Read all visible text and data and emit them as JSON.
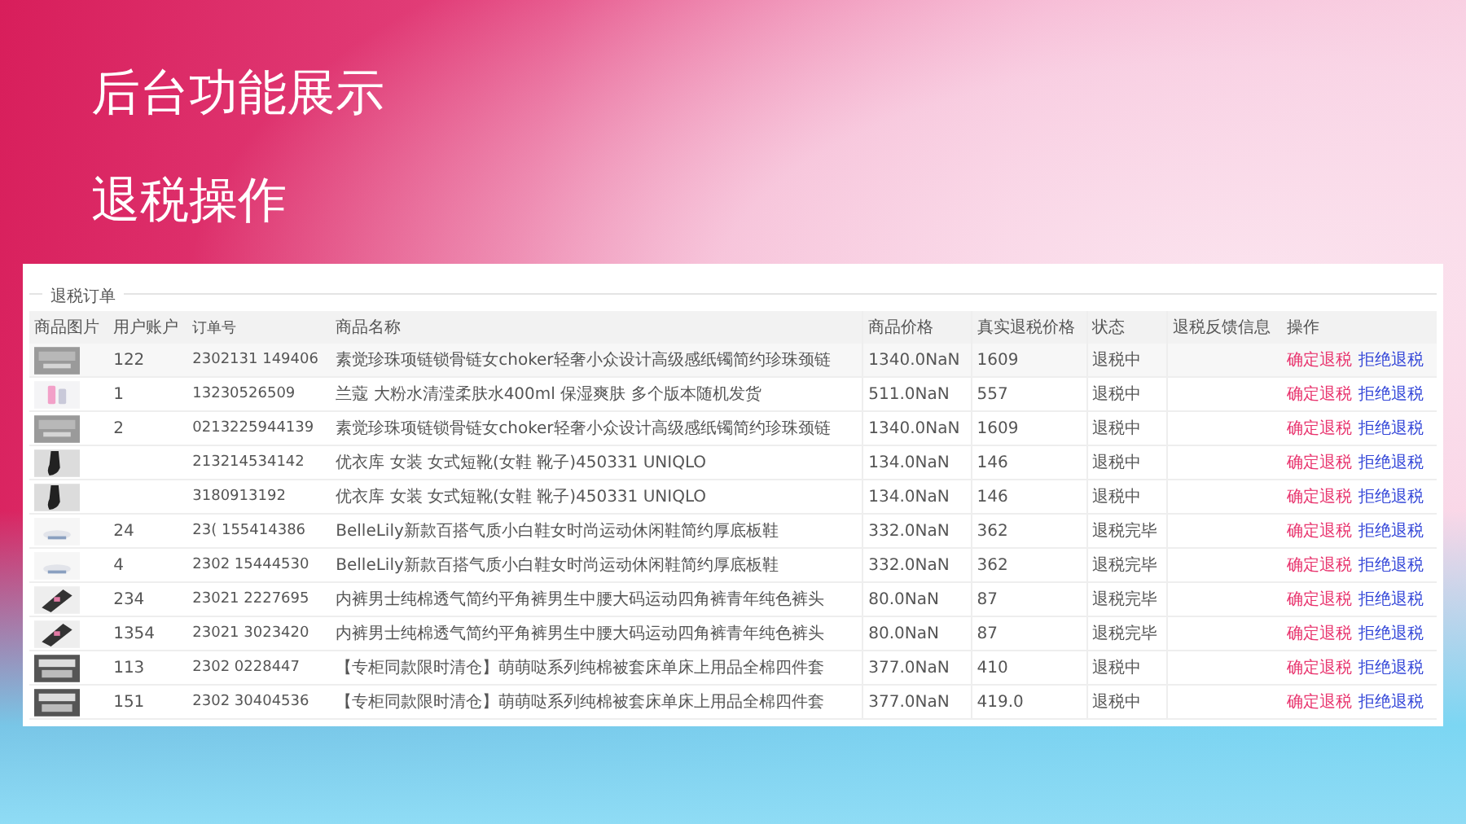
{
  "slide": {
    "title": "后台功能展示",
    "subtitle": "退税操作"
  },
  "panel": {
    "legend": "退税订单",
    "table": {
      "columns": [
        "商品图片",
        "用户账户",
        "订单号",
        "商品名称",
        "商品价格",
        "真实退税价格",
        "状态",
        "退税反馈信息",
        "操作"
      ],
      "rows": [
        {
          "account": "122",
          "order": "2302131  149406",
          "name": "素觉珍珠项链锁骨链女choker轻奢小众设计高级感纸镯简约珍珠颈链",
          "price": "1340.0NaN",
          "real_price": "1609",
          "status": "退税中",
          "actions": [
            {
              "label": "确定退税",
              "kind": "confirm"
            },
            {
              "label": "拒绝退税",
              "kind": "reject"
            }
          ]
        },
        {
          "account": "1",
          "order": "13230526509",
          "name": "兰蔻 大粉水清滢柔肤水400ml 保湿爽肤 多个版本随机发货",
          "price": "511.0NaN",
          "real_price": "557",
          "status": "退税中",
          "actions": [
            {
              "label": "确定退税",
              "kind": "confirm"
            },
            {
              "label": "拒绝退税",
              "kind": "reject"
            }
          ]
        },
        {
          "account": "2",
          "order": "0213225944139",
          "name": "素觉珍珠项链锁骨链女choker轻奢小众设计高级感纸镯简约珍珠颈链",
          "price": "1340.0NaN",
          "real_price": "1609",
          "status": "退税中",
          "actions": [
            {
              "label": "确定退税",
              "kind": "confirm"
            },
            {
              "label": "拒绝退税",
              "kind": "reject"
            }
          ]
        },
        {
          "order": "213214534142",
          "name": "优衣库 女装 女式短靴(女鞋 靴子)450331 UNIQLO",
          "price": "134.0NaN",
          "real_price": "146",
          "status": "退税中",
          "actions": [
            {
              "label": "确定退税",
              "kind": "confirm"
            },
            {
              "label": "拒绝退税",
              "kind": "reject"
            }
          ]
        },
        {
          "order": "3180913192",
          "name": "优衣库 女装 女式短靴(女鞋 靴子)450331 UNIQLO",
          "price": "134.0NaN",
          "real_price": "146",
          "status": "退税中",
          "actions": [
            {
              "label": "确定退税",
              "kind": "confirm"
            },
            {
              "label": "拒绝退税",
              "kind": "reject"
            }
          ]
        },
        {
          "account": "24",
          "order": "23(  155414386",
          "name": "BelleLily新款百搭气质小白鞋女时尚运动休闲鞋简约厚底板鞋",
          "price": "332.0NaN",
          "real_price": "362",
          "status": "退税完毕",
          "actions": [
            {
              "label": "确定退税",
              "kind": "confirm"
            },
            {
              "label": "拒绝退税",
              "kind": "reject"
            }
          ]
        },
        {
          "account": "4",
          "order": "2302  15444530",
          "name": "BelleLily新款百搭气质小白鞋女时尚运动休闲鞋简约厚底板鞋",
          "price": "332.0NaN",
          "real_price": "362",
          "status": "退税完毕",
          "actions": [
            {
              "label": "确定退税",
              "kind": "confirm"
            },
            {
              "label": "拒绝退税",
              "kind": "reject"
            }
          ]
        },
        {
          "account": "234",
          "order": "23021  2227695",
          "name": "内裤男士纯棉透气简约平角裤男生中腰大码运动四角裤青年纯色裤头",
          "price": "80.0NaN",
          "real_price": "87",
          "status": "退税完毕",
          "actions": [
            {
              "label": "确定退税",
              "kind": "confirm"
            },
            {
              "label": "拒绝退税",
              "kind": "reject"
            }
          ]
        },
        {
          "account": "1354",
          "order": "23021  3023420",
          "name": "内裤男士纯棉透气简约平角裤男生中腰大码运动四角裤青年纯色裤头",
          "price": "80.0NaN",
          "real_price": "87",
          "status": "退税完毕",
          "actions": [
            {
              "label": "确定退税",
              "kind": "confirm"
            },
            {
              "label": "拒绝退税",
              "kind": "reject"
            }
          ]
        },
        {
          "account": "113",
          "order": "2302  0228447",
          "name": "【专柜同款限时清仓】萌萌哒系列纯棉被套床单床上用品全棉四件套",
          "price": "377.0NaN",
          "real_price": "410",
          "status": "退税中",
          "actions": [
            {
              "label": "确定退税",
              "kind": "confirm"
            },
            {
              "label": "拒绝退税",
              "kind": "reject"
            }
          ]
        },
        {
          "account": "151",
          "order": "2302  30404536",
          "name": "【专柜同款限时清仓】萌萌哒系列纯棉被套床单床上用品全棉四件套",
          "price": "377.0NaN",
          "real_price": "419.0",
          "status": "退税中",
          "actions": [
            {
              "label": "确定退税",
              "kind": "confirm"
            },
            {
              "label": "拒绝退税",
              "kind": "reject"
            }
          ]
        }
      ]
    }
  }
}
